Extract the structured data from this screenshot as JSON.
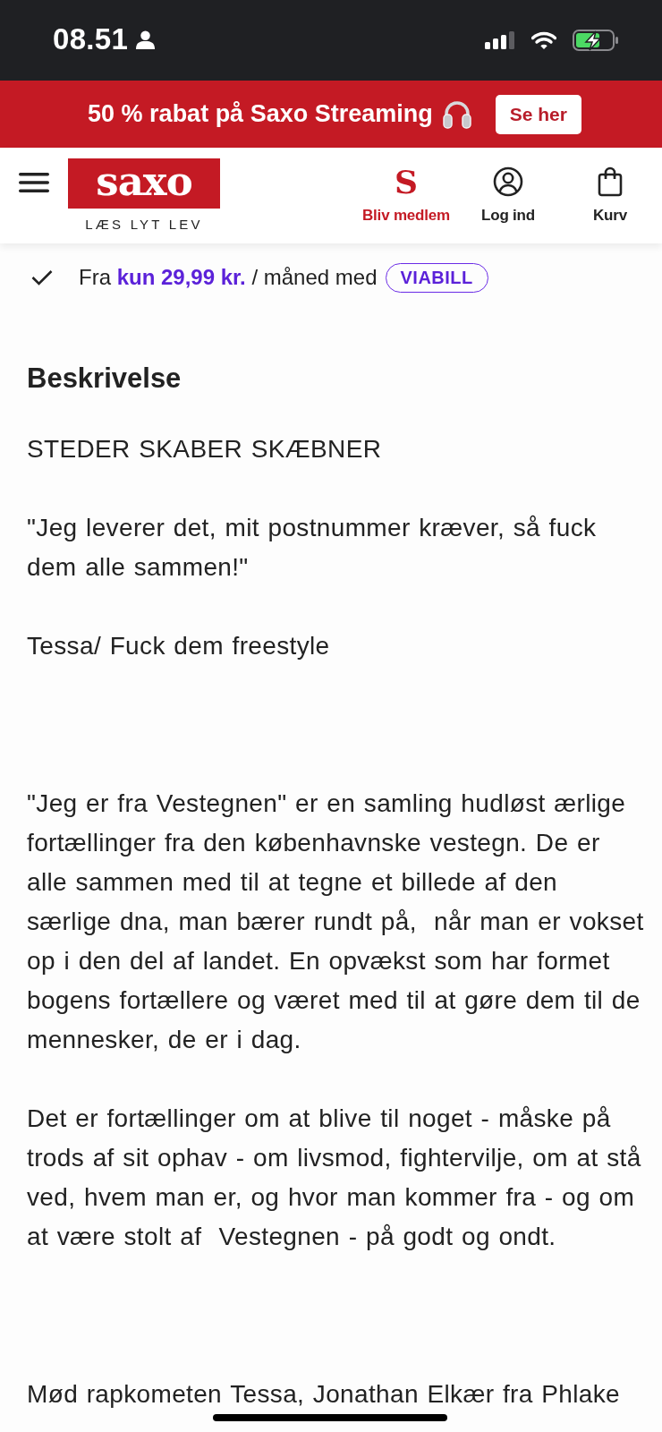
{
  "status_bar": {
    "time": "08.51"
  },
  "promo_banner": {
    "text": "50 % rabat på Saxo Streaming",
    "button": "Se her"
  },
  "header": {
    "logo": "saxo",
    "tagline": "LÆS LYT LEV",
    "actions": [
      {
        "kind": "member",
        "mark": "S",
        "label": "Bliv medlem"
      },
      {
        "kind": "login",
        "label": "Log ind"
      },
      {
        "kind": "cart",
        "label": "Kurv"
      }
    ]
  },
  "payment_note": {
    "text": "Fra **kun 29,99 kr.** / måned med",
    "badge": "VIABILL"
  },
  "description": {
    "heading": "Beskrivelse",
    "blocks": [
      [
        "STEDER SKABER SKÆBNER",
        "\"Jeg leverer det, mit postnummer kræver, så fuck dem alle sammen!\"",
        "Tessa/ Fuck dem freestyle"
      ],
      [
        "\"Jeg er fra Vestegnen\" er en samling hudløst ærlige fortællinger fra den københavnske vestegn. De er alle sammen med til at tegne et billede af den særlige dna, man bærer rundt på,  når man er vokset op i den del af landet. En opvækst som har formet bogens fortællere og været med til at gøre dem til de mennesker, de er i dag.",
        "Det er fortællinger om at blive til noget - måske på trods af sit ophav - om livsmod, fightervilje, om at stå ved, hvem man er, og hvor man kommer fra - og om at være stolt af  Vestegnen - på godt og ondt."
      ],
      [
        "Mød rapkometen Tessa, Jonathan Elkær fra Phlake"
      ]
    ]
  }
}
